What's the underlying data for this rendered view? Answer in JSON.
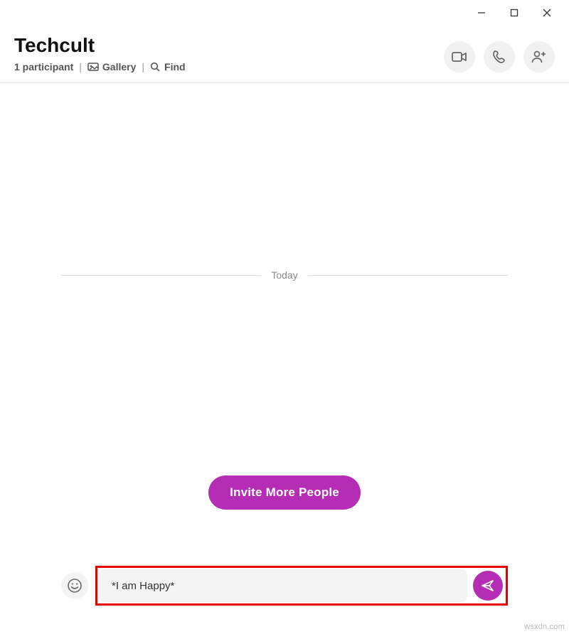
{
  "header": {
    "title": "Techcult",
    "participants": "1 participant",
    "gallery": "Gallery",
    "find": "Find"
  },
  "chat": {
    "date_label": "Today",
    "invite_label": "Invite More People"
  },
  "composer": {
    "message_value": "*I am Happy*"
  },
  "watermark": "wsxdn.com"
}
